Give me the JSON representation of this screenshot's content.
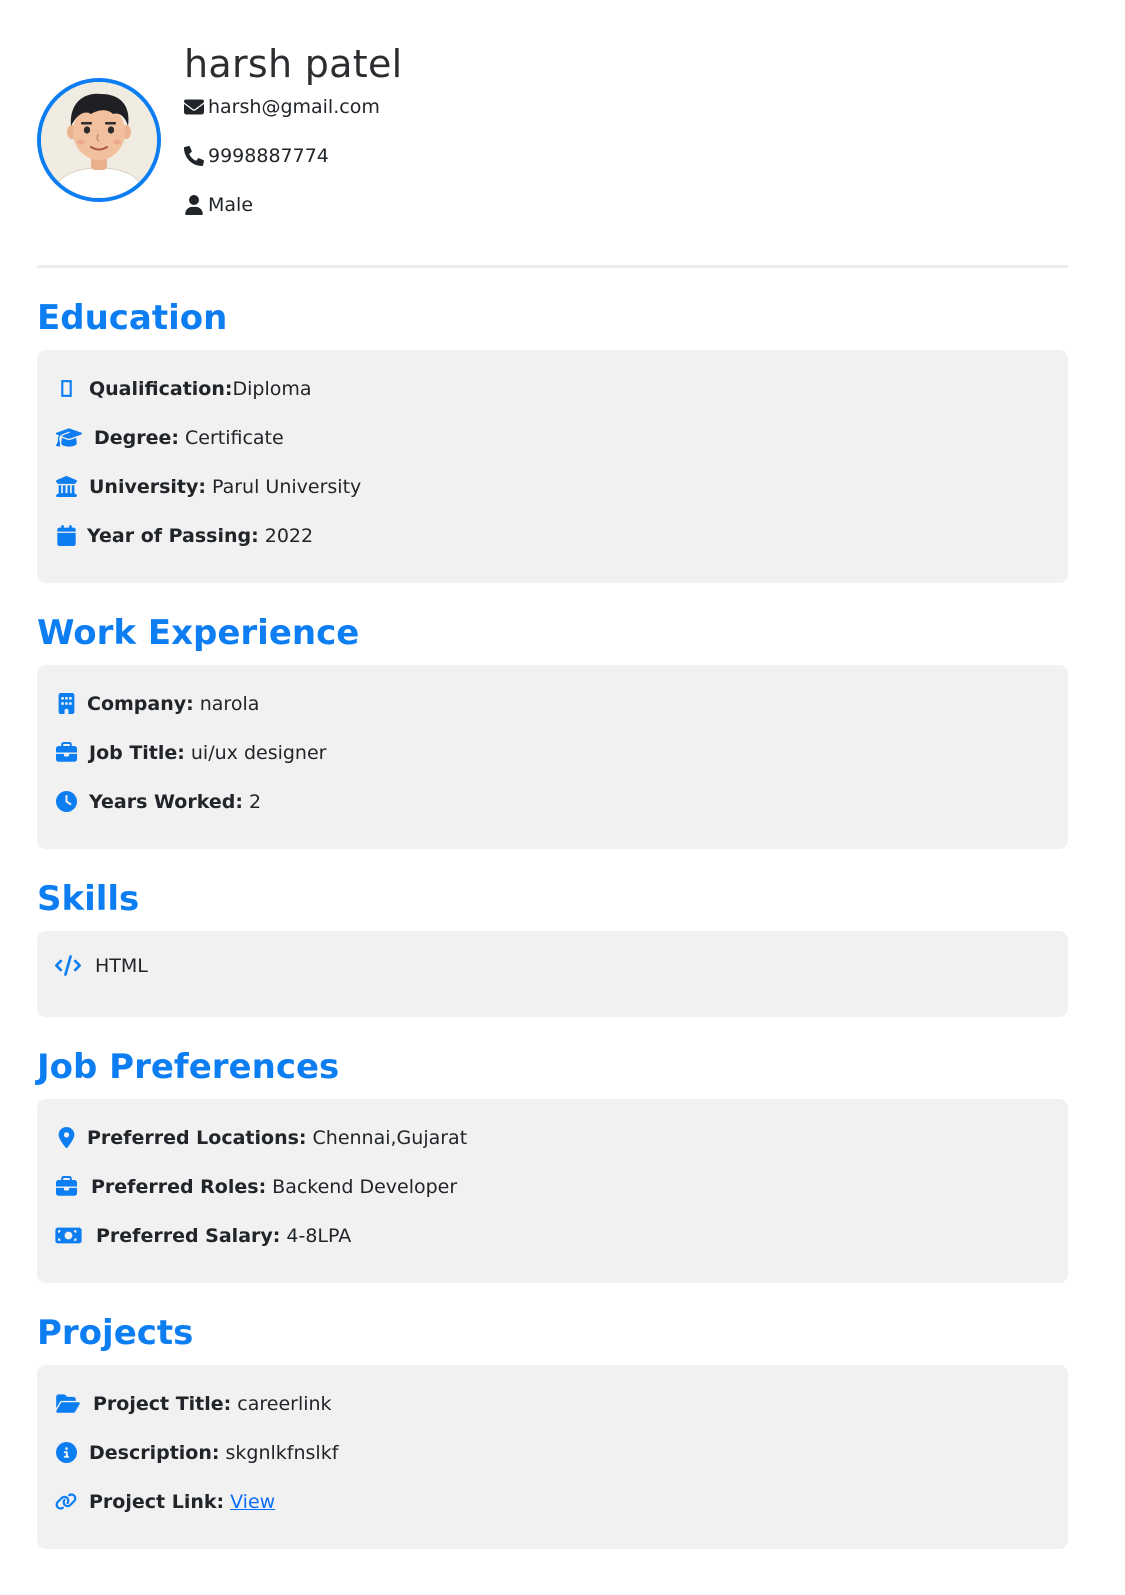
{
  "profile": {
    "name": "harsh patel",
    "email": "harsh@gmail.com",
    "phone": "9998887774",
    "gender": "Male",
    "avatar_icon": "avatar-illustration"
  },
  "colors": {
    "accent": "#0d7ef2",
    "card_bg": "#f1f1f1",
    "text": "#212529",
    "link": "#0d6efd"
  },
  "education": {
    "title": "Education",
    "qualification_label": "Qualification:",
    "qualification_value": "Diploma",
    "degree_label": "Degree:",
    "degree_value": "Certificate",
    "university_label": "University:",
    "university_value": "Parul University",
    "year_label": "Year of Passing:",
    "year_value": "2022"
  },
  "work": {
    "title": "Work Experience",
    "company_label": "Company:",
    "company_value": "narola",
    "job_title_label": "Job Title:",
    "job_title_value": "ui/ux designer",
    "years_label": "Years Worked:",
    "years_value": "2"
  },
  "skills": {
    "title": "Skills",
    "items": [
      "HTML"
    ]
  },
  "preferences": {
    "title": "Job Preferences",
    "locations_label": "Preferred Locations:",
    "locations_value": "Chennai,Gujarat",
    "roles_label": "Preferred Roles:",
    "roles_value": "Backend Developer",
    "salary_label": "Preferred Salary:",
    "salary_value": "4-8LPA"
  },
  "projects": {
    "title": "Projects",
    "project_title_label": "Project Title:",
    "project_title_value": "careerlink",
    "description_label": "Description:",
    "description_value": "skgnlkfnslkf",
    "link_label": "Project Link:",
    "link_text": "View"
  }
}
